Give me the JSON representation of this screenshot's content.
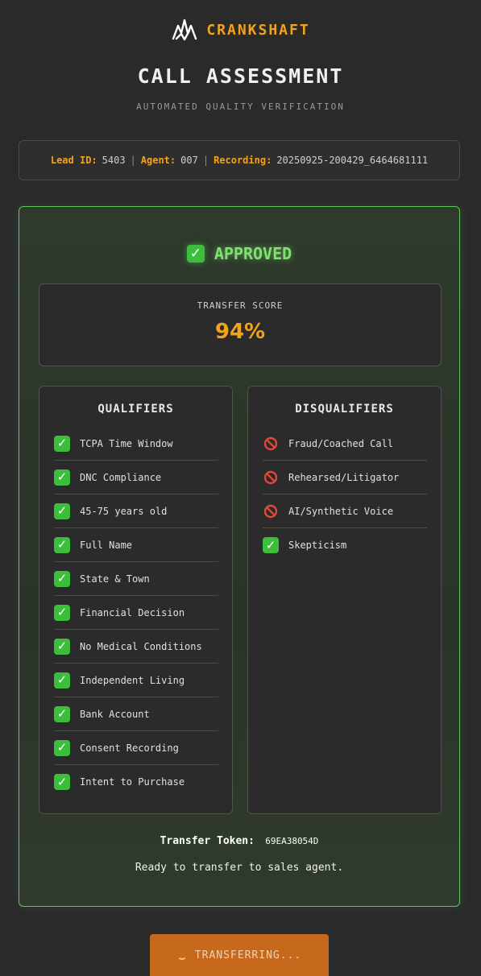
{
  "brand": {
    "name": "CRANKSHAFT",
    "color": "#f2a31c"
  },
  "header": {
    "title": "CALL ASSESSMENT",
    "subtitle": "AUTOMATED QUALITY VERIFICATION"
  },
  "meta": {
    "lead_id_label": "Lead ID:",
    "lead_id": "5403",
    "agent_label": "Agent:",
    "agent": "007",
    "recording_label": "Recording:",
    "recording": "20250925-200429_6464681111",
    "separator": "|"
  },
  "result": {
    "status_icon": "check-mark-icon",
    "status": "APPROVED",
    "score_label": "TRANSFER SCORE",
    "score": "94%"
  },
  "qualifiers": {
    "title": "QUALIFIERS",
    "items": [
      {
        "label": "TCPA Time Window",
        "icon": "check-icon"
      },
      {
        "label": "DNC Compliance",
        "icon": "check-icon"
      },
      {
        "label": "45-75 years old",
        "icon": "check-icon"
      },
      {
        "label": "Full Name",
        "icon": "check-icon"
      },
      {
        "label": "State & Town",
        "icon": "check-icon"
      },
      {
        "label": "Financial Decision",
        "icon": "check-icon"
      },
      {
        "label": "No Medical Conditions",
        "icon": "check-icon"
      },
      {
        "label": "Independent Living",
        "icon": "check-icon"
      },
      {
        "label": "Bank Account",
        "icon": "check-icon"
      },
      {
        "label": "Consent Recording",
        "icon": "check-icon"
      },
      {
        "label": "Intent to Purchase",
        "icon": "check-icon"
      }
    ]
  },
  "disqualifiers": {
    "title": "DISQUALIFIERS",
    "items": [
      {
        "label": "Fraud/Coached Call",
        "icon": "prohibited-icon"
      },
      {
        "label": "Rehearsed/Litigator",
        "icon": "prohibited-icon"
      },
      {
        "label": "AI/Synthetic Voice",
        "icon": "prohibited-icon"
      },
      {
        "label": "Skepticism",
        "icon": "check-icon"
      }
    ]
  },
  "footer": {
    "token_label": "Transfer Token:",
    "token": "69EA38054D",
    "ready_text": "Ready to transfer to sales agent."
  },
  "action": {
    "label": "TRANSFERRING..."
  },
  "colors": {
    "accent": "#f2a31c",
    "approved": "#7ee36e",
    "panel_border": "#5cc95c",
    "check": "#3cbe3c",
    "prohibited": "#e0483c",
    "button": "#c7691c"
  }
}
